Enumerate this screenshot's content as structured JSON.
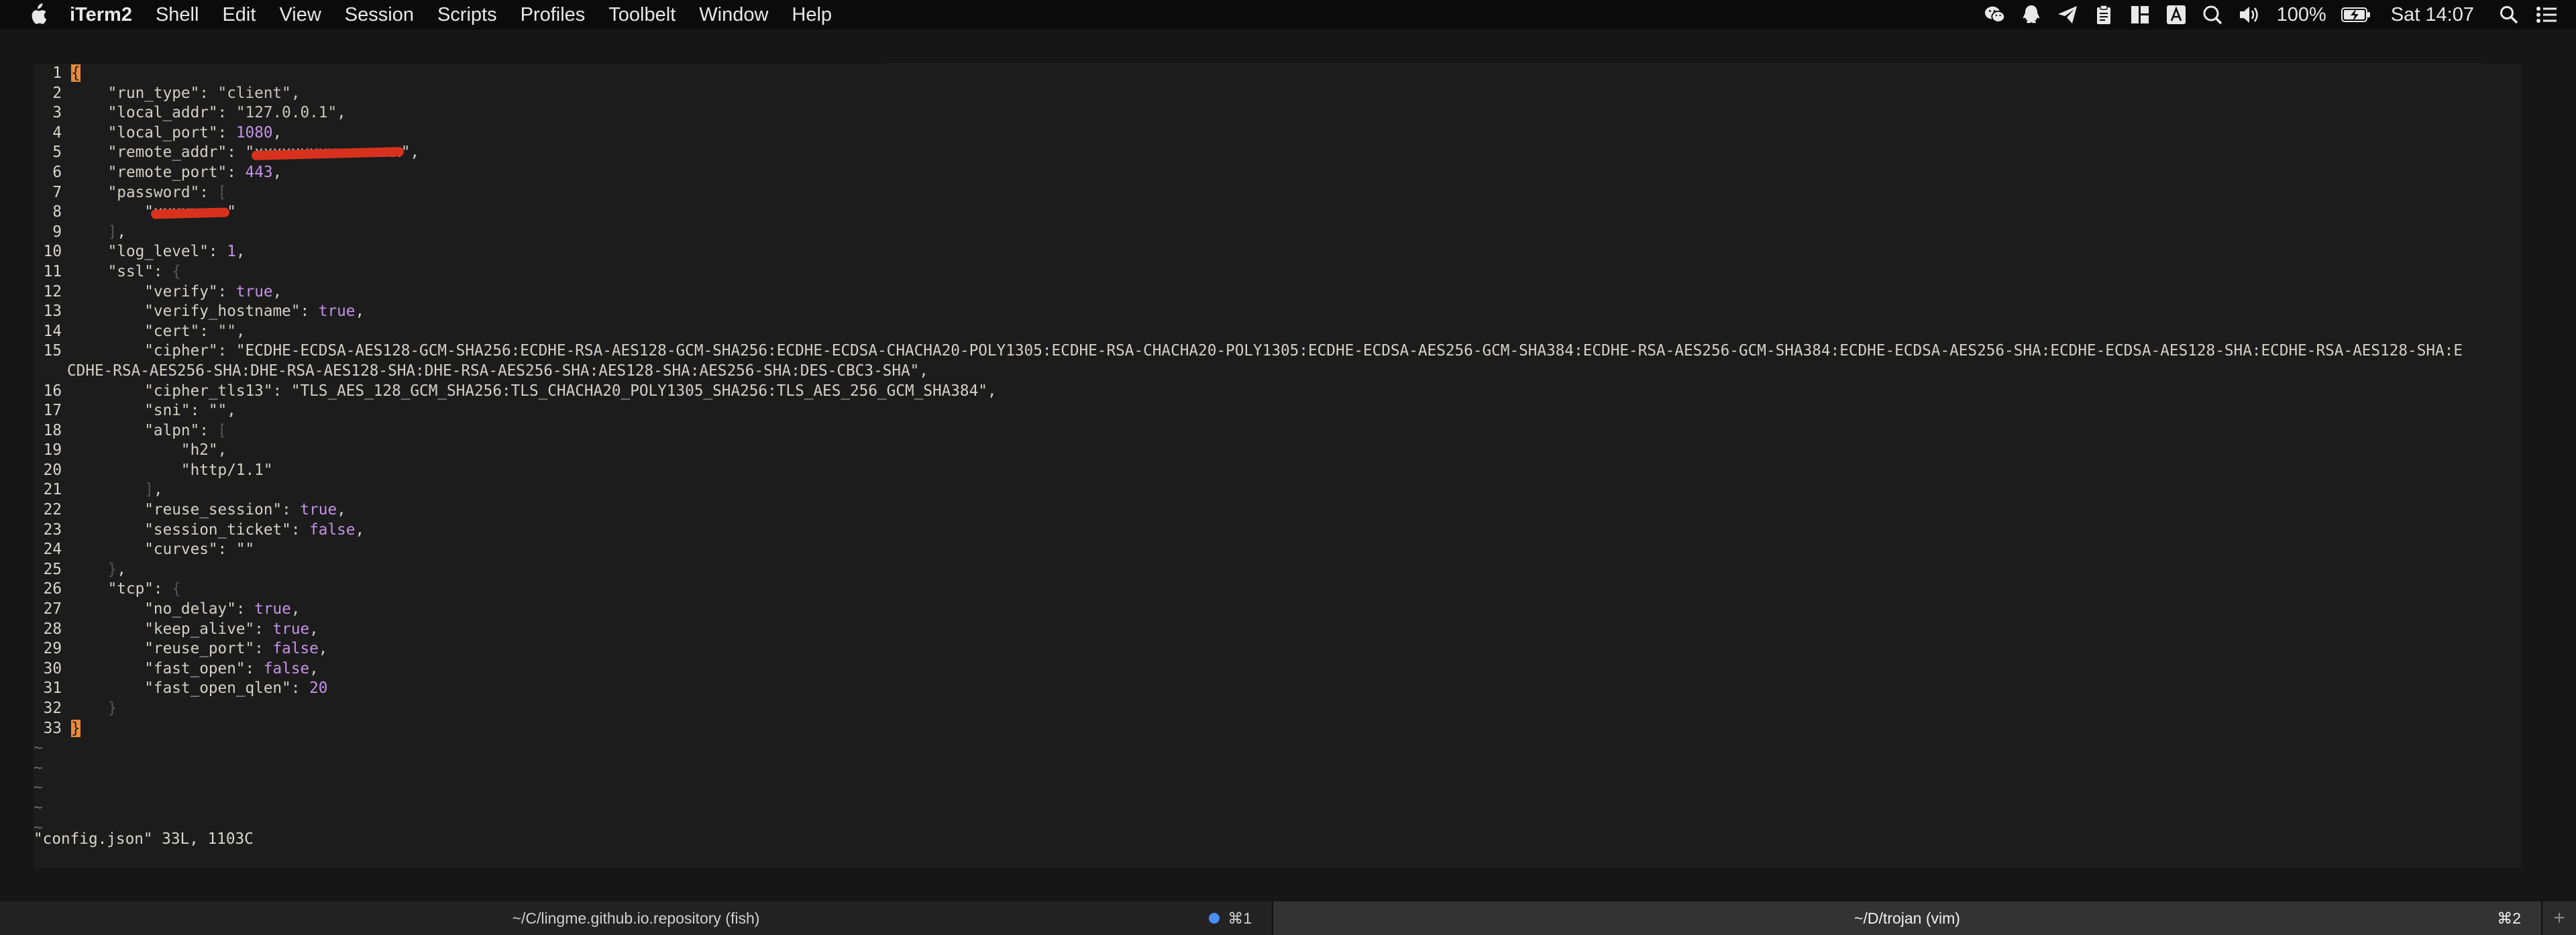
{
  "menubar": {
    "app": "iTerm2",
    "items": [
      "Shell",
      "Edit",
      "View",
      "Session",
      "Scripts",
      "Profiles",
      "Toolbelt",
      "Window",
      "Help"
    ],
    "battery": "100%",
    "clock": "Sat 14:07",
    "icons": [
      "wechat-icon",
      "qq-icon",
      "paper-plane-icon",
      "clipboard-icon",
      "grid-icon",
      "input-method-icon",
      "search-circle-icon",
      "volume-icon",
      "battery-icon",
      "spotlight-icon",
      "control-center-icon"
    ]
  },
  "editor": {
    "lines": [
      {
        "n": "1",
        "t": "{"
      },
      {
        "n": "2",
        "t": "    \"run_type\": \"client\","
      },
      {
        "n": "3",
        "t": "    \"local_addr\": \"127.0.0.1\","
      },
      {
        "n": "4",
        "t": "    \"local_port\": 1080,"
      },
      {
        "n": "5",
        "t": "    \"remote_addr\": \"[redacted]\","
      },
      {
        "n": "6",
        "t": "    \"remote_port\": 443,"
      },
      {
        "n": "7",
        "t": "    \"password\": ["
      },
      {
        "n": "8",
        "t": "        \"[redacted]\""
      },
      {
        "n": "9",
        "t": "    ],"
      },
      {
        "n": "10",
        "t": "    \"log_level\": 1,"
      },
      {
        "n": "11",
        "t": "    \"ssl\": {"
      },
      {
        "n": "12",
        "t": "        \"verify\": true,"
      },
      {
        "n": "13",
        "t": "        \"verify_hostname\": true,"
      },
      {
        "n": "14",
        "t": "        \"cert\": \"\","
      },
      {
        "n": "15",
        "t": "        \"cipher\": \"ECDHE-ECDSA-AES128-GCM-SHA256:ECDHE-RSA-AES128-GCM-SHA256:ECDHE-ECDSA-CHACHA20-POLY1305:ECDHE-RSA-CHACHA20-POLY1305:ECDHE-ECDSA-AES256-GCM-SHA384:ECDHE-RSA-AES256-GCM-SHA384:ECDHE-ECDSA-AES256-SHA:ECDHE-ECDSA-AES128-SHA:ECDHE-RSA-AES128-SHA:E"
      },
      {
        "n": "",
        "t": "CDHE-RSA-AES256-SHA:DHE-RSA-AES128-SHA:DHE-RSA-AES256-SHA:AES128-SHA:AES256-SHA:DES-CBC3-SHA\","
      },
      {
        "n": "16",
        "t": "        \"cipher_tls13\": \"TLS_AES_128_GCM_SHA256:TLS_CHACHA20_POLY1305_SHA256:TLS_AES_256_GCM_SHA384\","
      },
      {
        "n": "17",
        "t": "        \"sni\": \"\","
      },
      {
        "n": "18",
        "t": "        \"alpn\": ["
      },
      {
        "n": "19",
        "t": "            \"h2\","
      },
      {
        "n": "20",
        "t": "            \"http/1.1\""
      },
      {
        "n": "21",
        "t": "        ],"
      },
      {
        "n": "22",
        "t": "        \"reuse_session\": true,"
      },
      {
        "n": "23",
        "t": "        \"session_ticket\": false,"
      },
      {
        "n": "24",
        "t": "        \"curves\": \"\""
      },
      {
        "n": "25",
        "t": "    },"
      },
      {
        "n": "26",
        "t": "    \"tcp\": {"
      },
      {
        "n": "27",
        "t": "        \"no_delay\": true,"
      },
      {
        "n": "28",
        "t": "        \"keep_alive\": true,"
      },
      {
        "n": "29",
        "t": "        \"reuse_port\": false,"
      },
      {
        "n": "30",
        "t": "        \"fast_open\": false,"
      },
      {
        "n": "31",
        "t": "        \"fast_open_qlen\": 20"
      },
      {
        "n": "32",
        "t": "    }"
      },
      {
        "n": "33",
        "t": "}"
      }
    ],
    "tilde": "~",
    "status": "\"config.json\" 33L, 1103C"
  },
  "tabs": [
    {
      "title": "~/C/lingme.github.io.repository (fish)",
      "shortcut": "⌘1"
    },
    {
      "title": "~/D/trojan (vim)",
      "shortcut": "⌘2"
    }
  ],
  "new_tab": "+"
}
